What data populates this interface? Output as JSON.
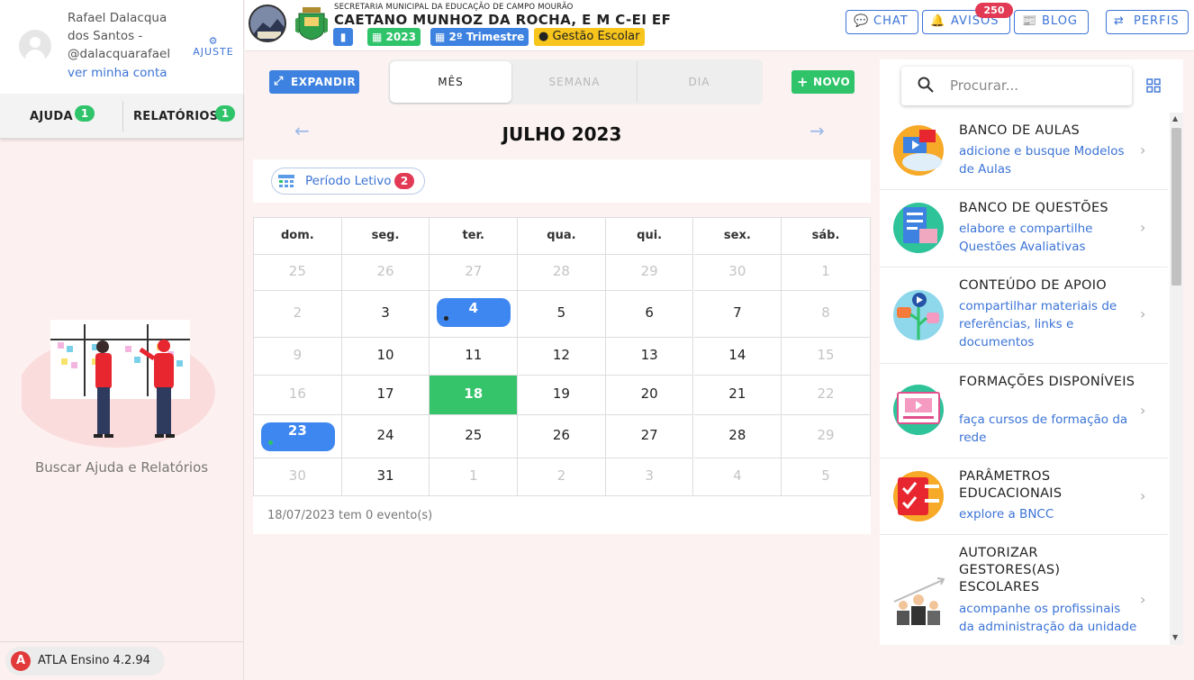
{
  "user": {
    "name": "Rafael Dalacqua dos Santos - @dalacquarafael",
    "account_link": "ver minha conta",
    "settings_label": "AJUSTE"
  },
  "help_tabs": [
    {
      "label": "AJUDA",
      "badge": "1"
    },
    {
      "label": "RELATÓRIOS",
      "badge": "1"
    }
  ],
  "help_caption": "Buscar Ajuda e Relatórios",
  "version": "ATLA Ensino 4.2.94",
  "header": {
    "secretaria": "SECRETARIA MUNICIPAL DA EDUCAÇÃO DE CAMPO MOURÃO",
    "school": "CAETANO MUNHOZ DA ROCHA, E M C-EI EF",
    "year": "2023",
    "trimester": "2º Trimestre",
    "gestao": "Gestão Escolar",
    "buttons": {
      "chat": "CHAT",
      "avisos": "AVISOS",
      "blog": "BLOG",
      "perfis": "PERFIS"
    },
    "avisos_badge": "250"
  },
  "calendar": {
    "expand_label": "EXPANDIR",
    "views": [
      "MÊS",
      "SEMANA",
      "DIA"
    ],
    "new_label": "NOVO",
    "month_title": "JULHO 2023",
    "periodo_label": "Período Letivo",
    "periodo_badge": "2",
    "weekdays": [
      "dom.",
      "seg.",
      "ter.",
      "qua.",
      "qui.",
      "sex.",
      "sáb."
    ],
    "weeks": [
      [
        "25",
        "26",
        "27",
        "28",
        "29",
        "30",
        "1"
      ],
      [
        "2",
        "3",
        "4",
        "5",
        "6",
        "7",
        "8"
      ],
      [
        "9",
        "10",
        "11",
        "12",
        "13",
        "14",
        "15"
      ],
      [
        "16",
        "17",
        "18",
        "19",
        "20",
        "21",
        "22"
      ],
      [
        "23",
        "24",
        "25",
        "26",
        "27",
        "28",
        "29"
      ],
      [
        "30",
        "31",
        "1",
        "2",
        "3",
        "4",
        "5"
      ]
    ],
    "footer": "18/07/2023 tem 0 evento(s)",
    "colors": {
      "today": "#35c46a",
      "event": "#3f87f0"
    }
  },
  "search": {
    "placeholder": "Procurar..."
  },
  "resources": [
    {
      "title": "BANCO DE AULAS",
      "desc": "adicione e busque Modelos de Aulas",
      "icon": "lesson-bank-icon"
    },
    {
      "title": "BANCO DE QUESTÕES",
      "desc": "elabore e compartilhe Questões Avaliativas",
      "icon": "question-bank-icon"
    },
    {
      "title": "CONTEÚDO DE APOIO",
      "desc": "compartilhar materiais de referências, links e documentos",
      "icon": "support-content-icon"
    },
    {
      "title": "FORMAÇÕES DISPONÍVEIS",
      "desc": "faça cursos de formação da rede",
      "icon": "training-icon"
    },
    {
      "title": "PARÂMETROS EDUCACIONAIS",
      "desc": "explore a BNCC",
      "icon": "parameters-icon"
    },
    {
      "title": "AUTORIZAR GESTORES(AS) ESCOLARES",
      "desc": "acompanhe os profissinais da administração da unidade",
      "icon": "managers-icon"
    }
  ]
}
